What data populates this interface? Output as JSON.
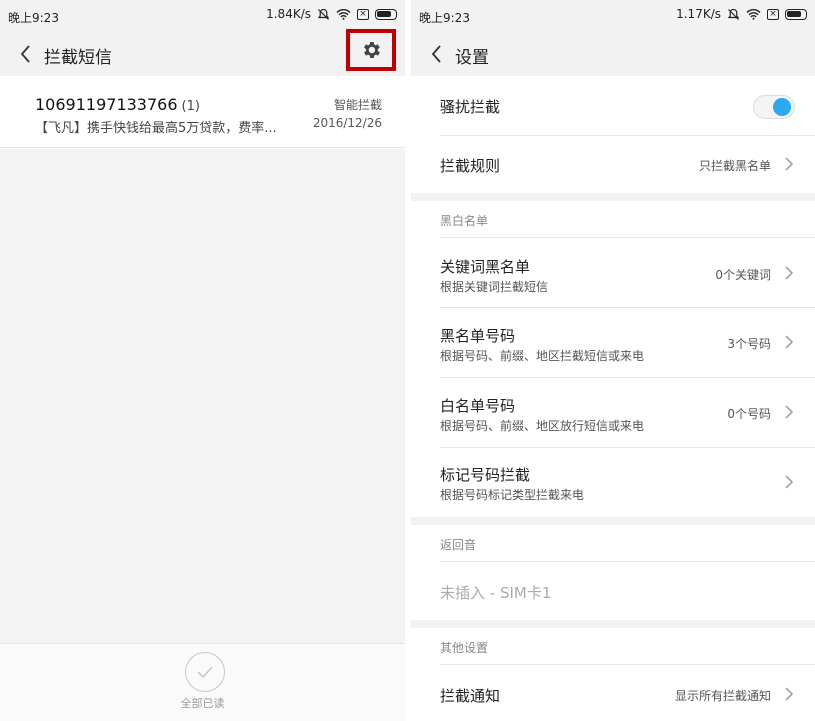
{
  "left": {
    "status": {
      "time": "晚上9:23",
      "speed": "1.84K/s"
    },
    "title": "拦截短信",
    "message": {
      "number": "10691197133766",
      "count": "(1)",
      "preview": "【飞凡】携手快钱给最高5万贷款，费率...",
      "tag": "智能拦截",
      "date": "2016/12/26"
    },
    "bottom": {
      "read_all": "全部已读"
    }
  },
  "right": {
    "status": {
      "time": "晚上9:23",
      "speed": "1.17K/s"
    },
    "title": "设置",
    "harass": {
      "label": "骚扰拦截",
      "enabled": true
    },
    "rule": {
      "label": "拦截规则",
      "value": "只拦截黑名单"
    },
    "section_lists": "黑白名单",
    "keyword": {
      "label": "关键词黑名单",
      "sub": "根据关键词拦截短信",
      "value": "0个关键词"
    },
    "black": {
      "label": "黑名单号码",
      "sub": "根据号码、前缀、地区拦截短信或来电",
      "value": "3个号码"
    },
    "white": {
      "label": "白名单号码",
      "sub": "根据号码、前缀、地区放行短信或来电",
      "value": "0个号码"
    },
    "mark": {
      "label": "标记号码拦截",
      "sub": "根据号码标记类型拦截来电"
    },
    "section_ring": "返回音",
    "sim": {
      "label": "未插入 - SIM卡1"
    },
    "section_other": "其他设置",
    "notify": {
      "label": "拦截通知",
      "value": "显示所有拦截通知"
    }
  },
  "colors": {
    "accent": "#2aa8f2",
    "highlight_box": "#c00000"
  }
}
